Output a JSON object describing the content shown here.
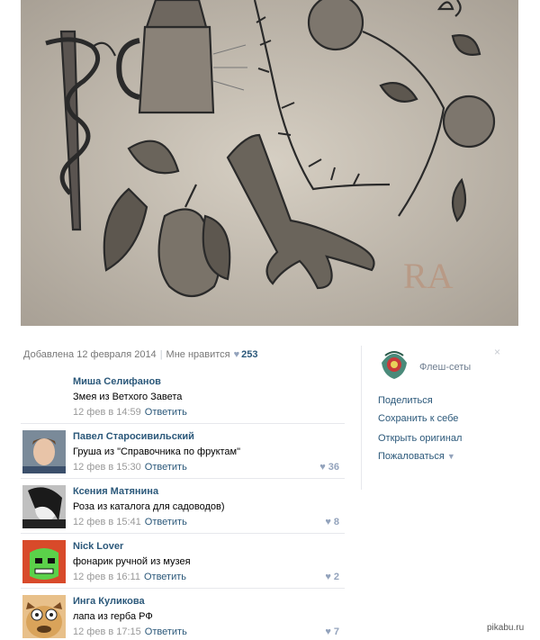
{
  "photo": {
    "alt_description": ""
  },
  "meta": {
    "added": "Добавлена 12 февраля 2014",
    "like_label": "Мне нравится",
    "like_count": "253"
  },
  "sidebar": {
    "album_name": "Флеш-сеты",
    "actions": {
      "share": "Поделиться",
      "save": "Сохранить к себе",
      "open_original": "Открыть оригинал",
      "report": "Пожаловаться"
    }
  },
  "comments": [
    {
      "name": "Миша Селифанов",
      "text": "Змея из Ветхого Завета",
      "date": "12 фев в 14:59",
      "reply": "Ответить",
      "likes": ""
    },
    {
      "name": "Павел Старосивильский",
      "text": "Груша из \"Справочника по фруктам\"",
      "date": "12 фев в 15:30",
      "reply": "Ответить",
      "likes": "36"
    },
    {
      "name": "Ксения Матянина",
      "text": "Роза из каталога для садоводов)",
      "date": "12 фев в 15:41",
      "reply": "Ответить",
      "likes": "8"
    },
    {
      "name": "Nick Lover",
      "text": "фонарик ручной из музея",
      "date": "12 фев в 16:11",
      "reply": "Ответить",
      "likes": "2"
    },
    {
      "name": "Инга Куликова",
      "text": "лапа из герба РФ",
      "date": "12 фев в 17:15",
      "reply": "Ответить",
      "likes": "7"
    }
  ],
  "watermark": "pikabu.ru",
  "colors": {
    "link": "#2b587a",
    "muted": "#777777",
    "heart": "#93a3bc",
    "divider": "#e7e8ec"
  }
}
